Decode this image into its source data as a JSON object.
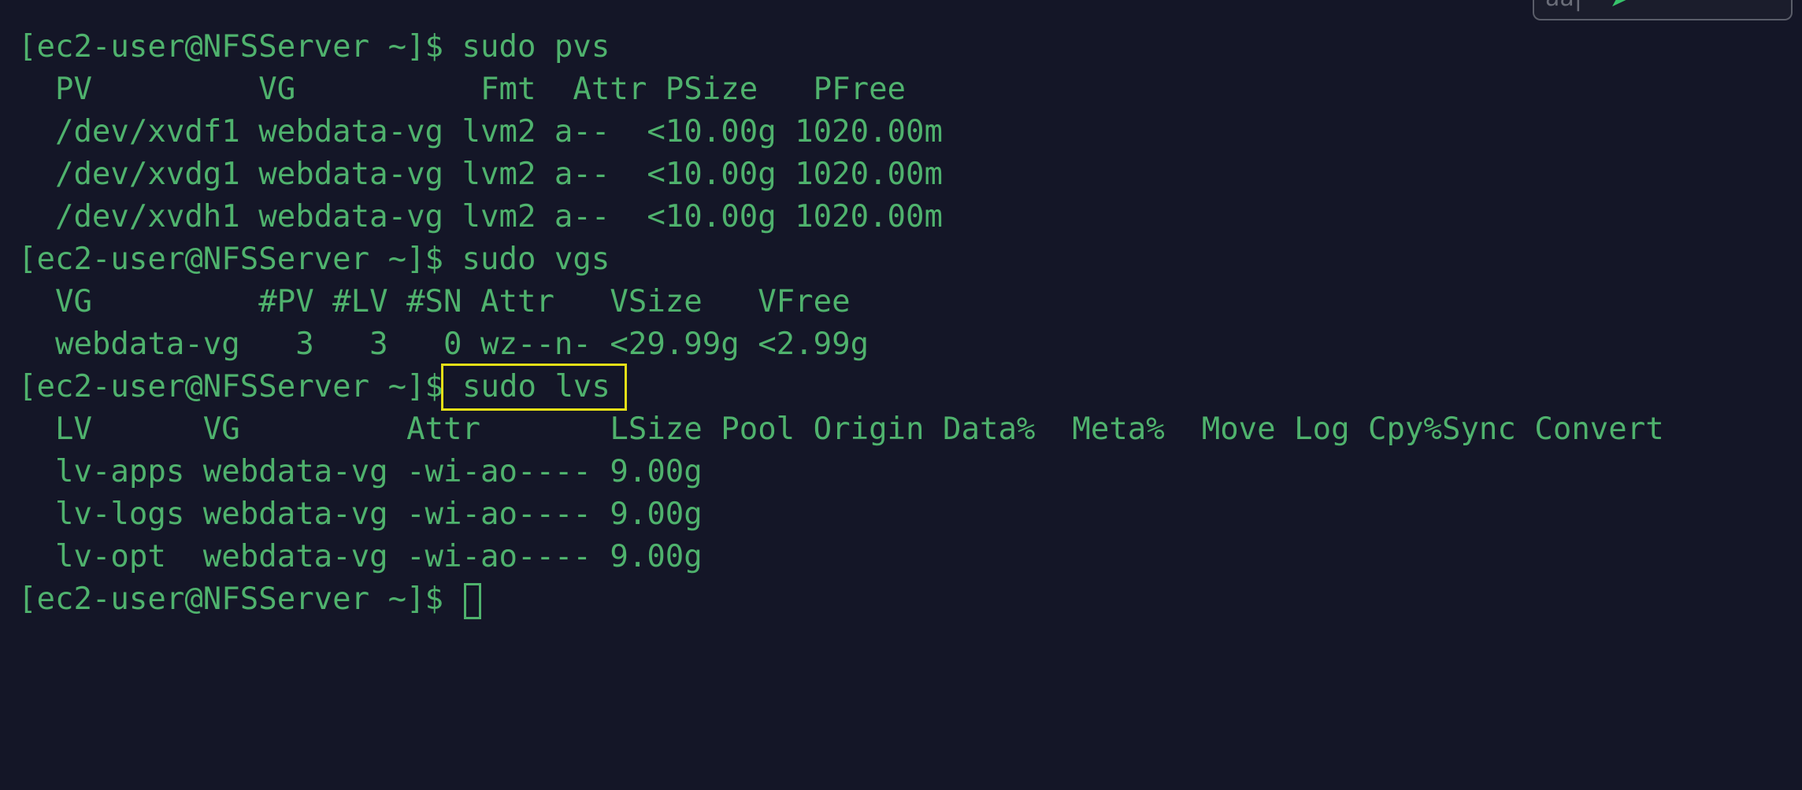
{
  "terminal": {
    "prompt": "[ec2-user@NFSServer ~]$",
    "blocks": {
      "pvs_command": "sudo pvs",
      "pvs_header": "  PV         VG          Fmt  Attr PSize   PFree",
      "pvs_rows": [
        "  /dev/xvdf1 webdata-vg lvm2 a--  <10.00g 1020.00m",
        "  /dev/xvdg1 webdata-vg lvm2 a--  <10.00g 1020.00m",
        "  /dev/xvdh1 webdata-vg lvm2 a--  <10.00g 1020.00m"
      ],
      "vgs_command": "sudo vgs",
      "vgs_header": "  VG         #PV #LV #SN Attr   VSize   VFree",
      "vgs_rows": [
        "  webdata-vg   3   3   0 wz--n- <29.99g <2.99g"
      ],
      "lvs_command": "sudo lvs",
      "lvs_header": "  LV      VG         Attr       LSize Pool Origin Data%  Meta%  Move Log Cpy%Sync Convert",
      "lvs_rows": [
        "  lv-apps webdata-vg -wi-ao---- 9.00g",
        "  lv-logs webdata-vg -wi-ao---- 9.00g",
        "  lv-opt  webdata-vg -wi-ao---- 9.00g"
      ]
    },
    "colors": {
      "background": "#141627",
      "text": "#4fb26d",
      "highlight": "#e4df17"
    }
  },
  "corner_widget": {
    "text": "aa|",
    "icon": "cursor-arrow-icon"
  }
}
